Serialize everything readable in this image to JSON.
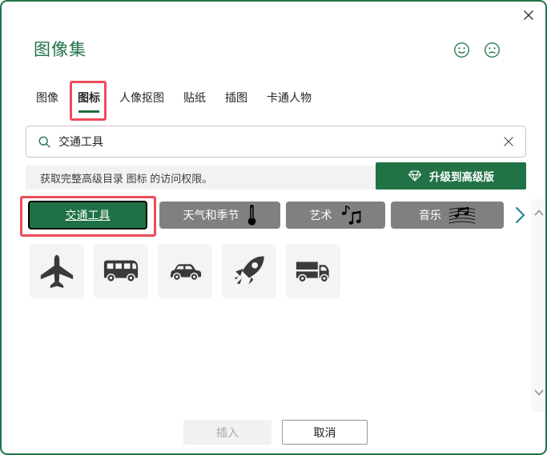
{
  "dialog": {
    "title": "图像集"
  },
  "header": {
    "close_icon": "close-icon",
    "feedback_icons": [
      "happy-face-icon",
      "sad-face-icon"
    ]
  },
  "tabs": {
    "items": [
      {
        "label": "图像",
        "selected": false
      },
      {
        "label": "图标",
        "selected": true,
        "annotated": true
      },
      {
        "label": "人像抠图",
        "selected": false
      },
      {
        "label": "贴纸",
        "selected": false
      },
      {
        "label": "插图",
        "selected": false
      },
      {
        "label": "卡通人物",
        "selected": false
      }
    ]
  },
  "search": {
    "value": "交通工具",
    "icon": "search-icon",
    "clear_icon": "close-icon"
  },
  "banner": {
    "text": "获取完整高级目录 图标 的访问权限。",
    "button_label": "升级到高级版",
    "button_icon": "gem-icon"
  },
  "categories": {
    "items": [
      {
        "label": "交通工具",
        "selected": true,
        "annotated": true,
        "icon": null
      },
      {
        "label": "天气和季节",
        "selected": false,
        "icon": "thermometer-icon"
      },
      {
        "label": "艺术",
        "selected": false,
        "icon": "music-notes-icon"
      },
      {
        "label": "音乐",
        "selected": false,
        "icon": "sheet-music-icon"
      }
    ],
    "next_icon": "chevron-right-icon"
  },
  "results": {
    "icons": [
      "airplane-icon",
      "bus-icon",
      "car-icon",
      "rocket-icon",
      "truck-icon"
    ]
  },
  "scrollbar": {
    "up_icon": "chevron-up-icon",
    "down_icon": "chevron-down-icon"
  },
  "footer": {
    "insert_label": "插入",
    "insert_enabled": false,
    "cancel_label": "取消"
  },
  "colors": {
    "accent_green": "#217346",
    "selected_pill_green": "#1f7145",
    "pill_gray": "#808080",
    "annotation_red": "#ee4b5a",
    "next_chevron_teal": "#1d7e93",
    "banner_gray": "#f2f2f2",
    "tile_gray": "#f4f4f4",
    "icon_black": "#3a3a3a"
  }
}
